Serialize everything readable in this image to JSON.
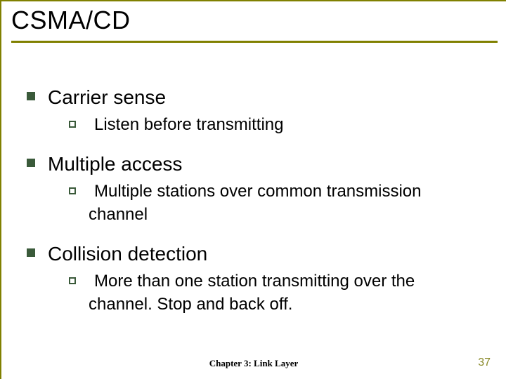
{
  "title": "CSMA/CD",
  "items": [
    {
      "label": "Carrier sense",
      "sub": "Listen before transmitting"
    },
    {
      "label": "Multiple access",
      "sub": "Multiple stations over common transmission channel"
    },
    {
      "label": "Collision detection",
      "sub": "More than one station transmitting over the channel. Stop and back off."
    }
  ],
  "footer": {
    "center": "Chapter 3: Link Layer",
    "page": "37"
  }
}
